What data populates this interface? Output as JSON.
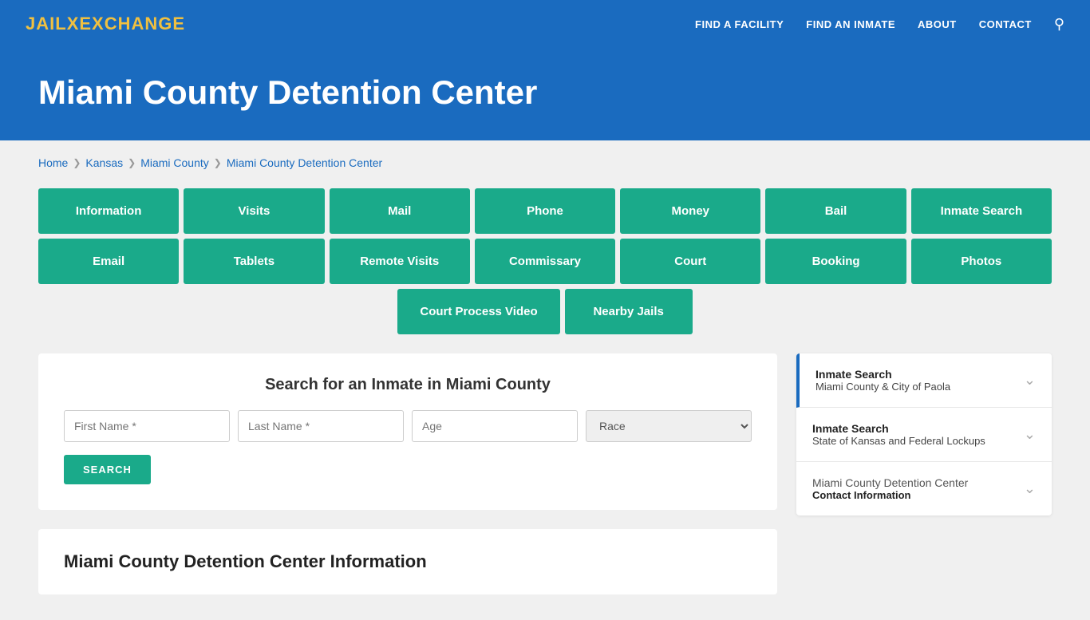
{
  "nav": {
    "logo_jail": "JAIL",
    "logo_exchange": "EXCHANGE",
    "links": [
      {
        "label": "FIND A FACILITY",
        "name": "find-a-facility"
      },
      {
        "label": "FIND AN INMATE",
        "name": "find-an-inmate"
      },
      {
        "label": "ABOUT",
        "name": "about"
      },
      {
        "label": "CONTACT",
        "name": "contact"
      }
    ]
  },
  "hero": {
    "title": "Miami County Detention Center"
  },
  "breadcrumb": {
    "items": [
      {
        "label": "Home",
        "name": "bc-home"
      },
      {
        "label": "Kansas",
        "name": "bc-kansas"
      },
      {
        "label": "Miami County",
        "name": "bc-miami-county"
      },
      {
        "label": "Miami County Detention Center",
        "name": "bc-facility"
      }
    ]
  },
  "buttons_row1": [
    {
      "label": "Information",
      "name": "btn-information"
    },
    {
      "label": "Visits",
      "name": "btn-visits"
    },
    {
      "label": "Mail",
      "name": "btn-mail"
    },
    {
      "label": "Phone",
      "name": "btn-phone"
    },
    {
      "label": "Money",
      "name": "btn-money"
    },
    {
      "label": "Bail",
      "name": "btn-bail"
    },
    {
      "label": "Inmate Search",
      "name": "btn-inmate-search"
    }
  ],
  "buttons_row2": [
    {
      "label": "Email",
      "name": "btn-email"
    },
    {
      "label": "Tablets",
      "name": "btn-tablets"
    },
    {
      "label": "Remote Visits",
      "name": "btn-remote-visits"
    },
    {
      "label": "Commissary",
      "name": "btn-commissary"
    },
    {
      "label": "Court",
      "name": "btn-court"
    },
    {
      "label": "Booking",
      "name": "btn-booking"
    },
    {
      "label": "Photos",
      "name": "btn-photos"
    }
  ],
  "buttons_row3": [
    {
      "label": "Court Process Video",
      "name": "btn-court-process-video"
    },
    {
      "label": "Nearby Jails",
      "name": "btn-nearby-jails"
    }
  ],
  "search": {
    "title": "Search for an Inmate in Miami County",
    "first_name_placeholder": "First Name *",
    "last_name_placeholder": "Last Name *",
    "age_placeholder": "Age",
    "race_placeholder": "Race",
    "button_label": "SEARCH"
  },
  "info_section": {
    "title": "Miami County Detention Center Information"
  },
  "sidebar": {
    "items": [
      {
        "main_label": "Inmate Search",
        "sub_label": "Miami County & City of Paola",
        "active": true,
        "name": "sidebar-inmate-search-miami"
      },
      {
        "main_label": "Inmate Search",
        "sub_label": "State of Kansas and Federal Lockups",
        "active": false,
        "name": "sidebar-inmate-search-kansas"
      },
      {
        "main_label": "Miami County Detention Center",
        "sub_label": "Contact Information",
        "active": false,
        "name": "sidebar-contact-info"
      }
    ]
  }
}
